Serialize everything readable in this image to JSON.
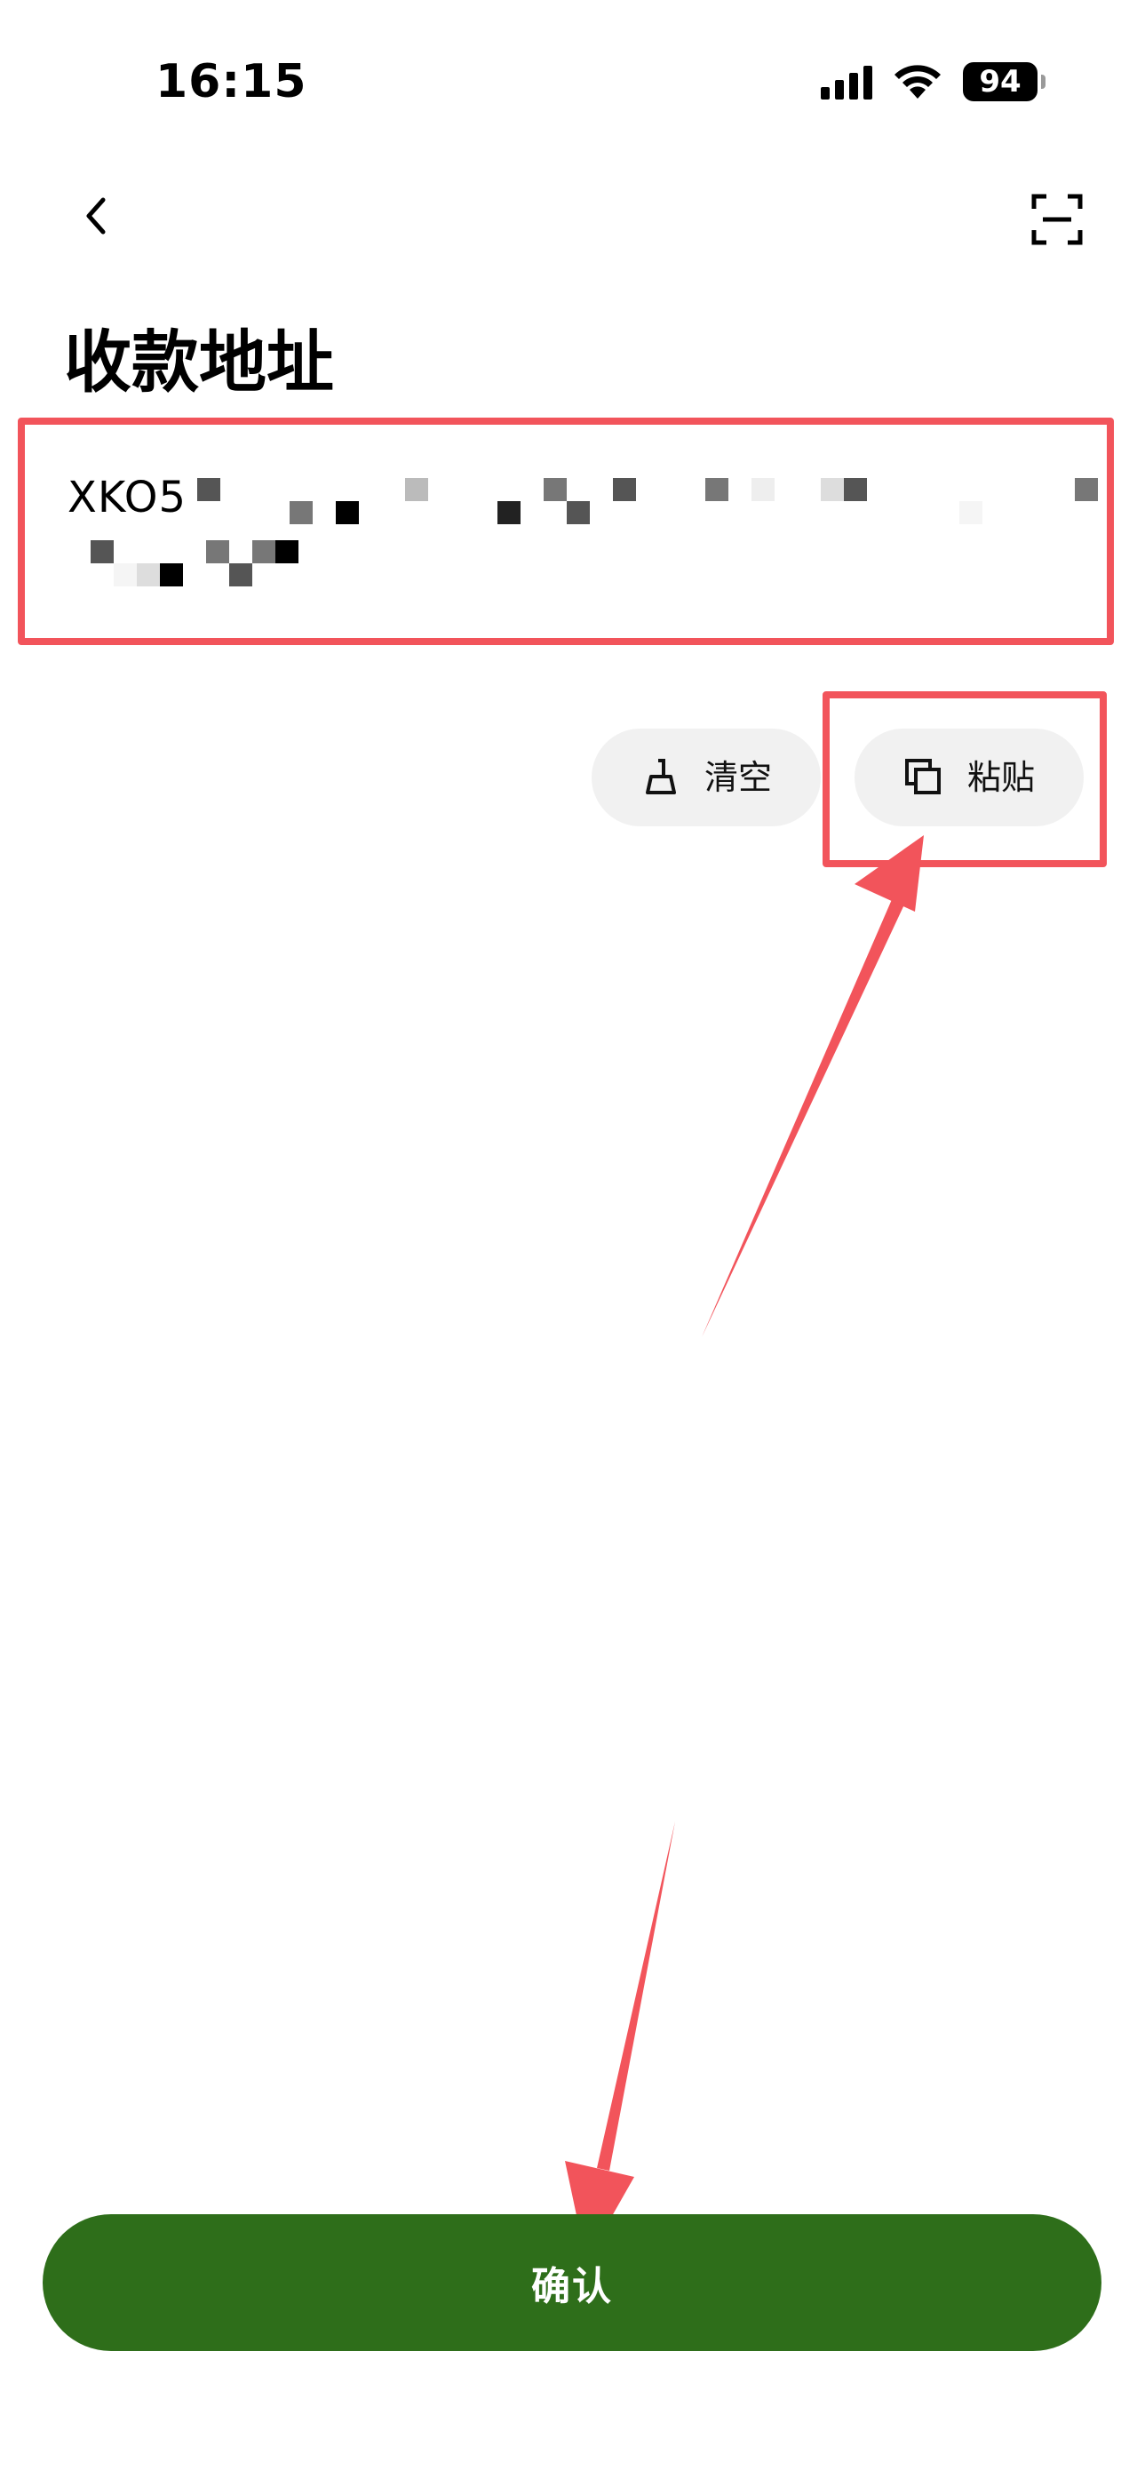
{
  "status_bar": {
    "time": "16:15",
    "battery": "94",
    "icons": [
      "signal-icon",
      "wifi-icon",
      "battery-icon"
    ]
  },
  "nav": {
    "back_icon": "chevron-left-icon",
    "scan_icon": "scan-icon"
  },
  "page": {
    "title": "收款地址"
  },
  "address": {
    "value": "XKO5",
    "obscured": true
  },
  "actions": {
    "clear_label": "清空",
    "clear_icon": "broom-icon",
    "paste_label": "粘贴",
    "paste_icon": "copy-icon"
  },
  "confirm": {
    "label": "确认"
  },
  "colors": {
    "accent": "#2e6e1a",
    "annotation": "#f2545b",
    "chip_bg": "#f1f1f1"
  }
}
